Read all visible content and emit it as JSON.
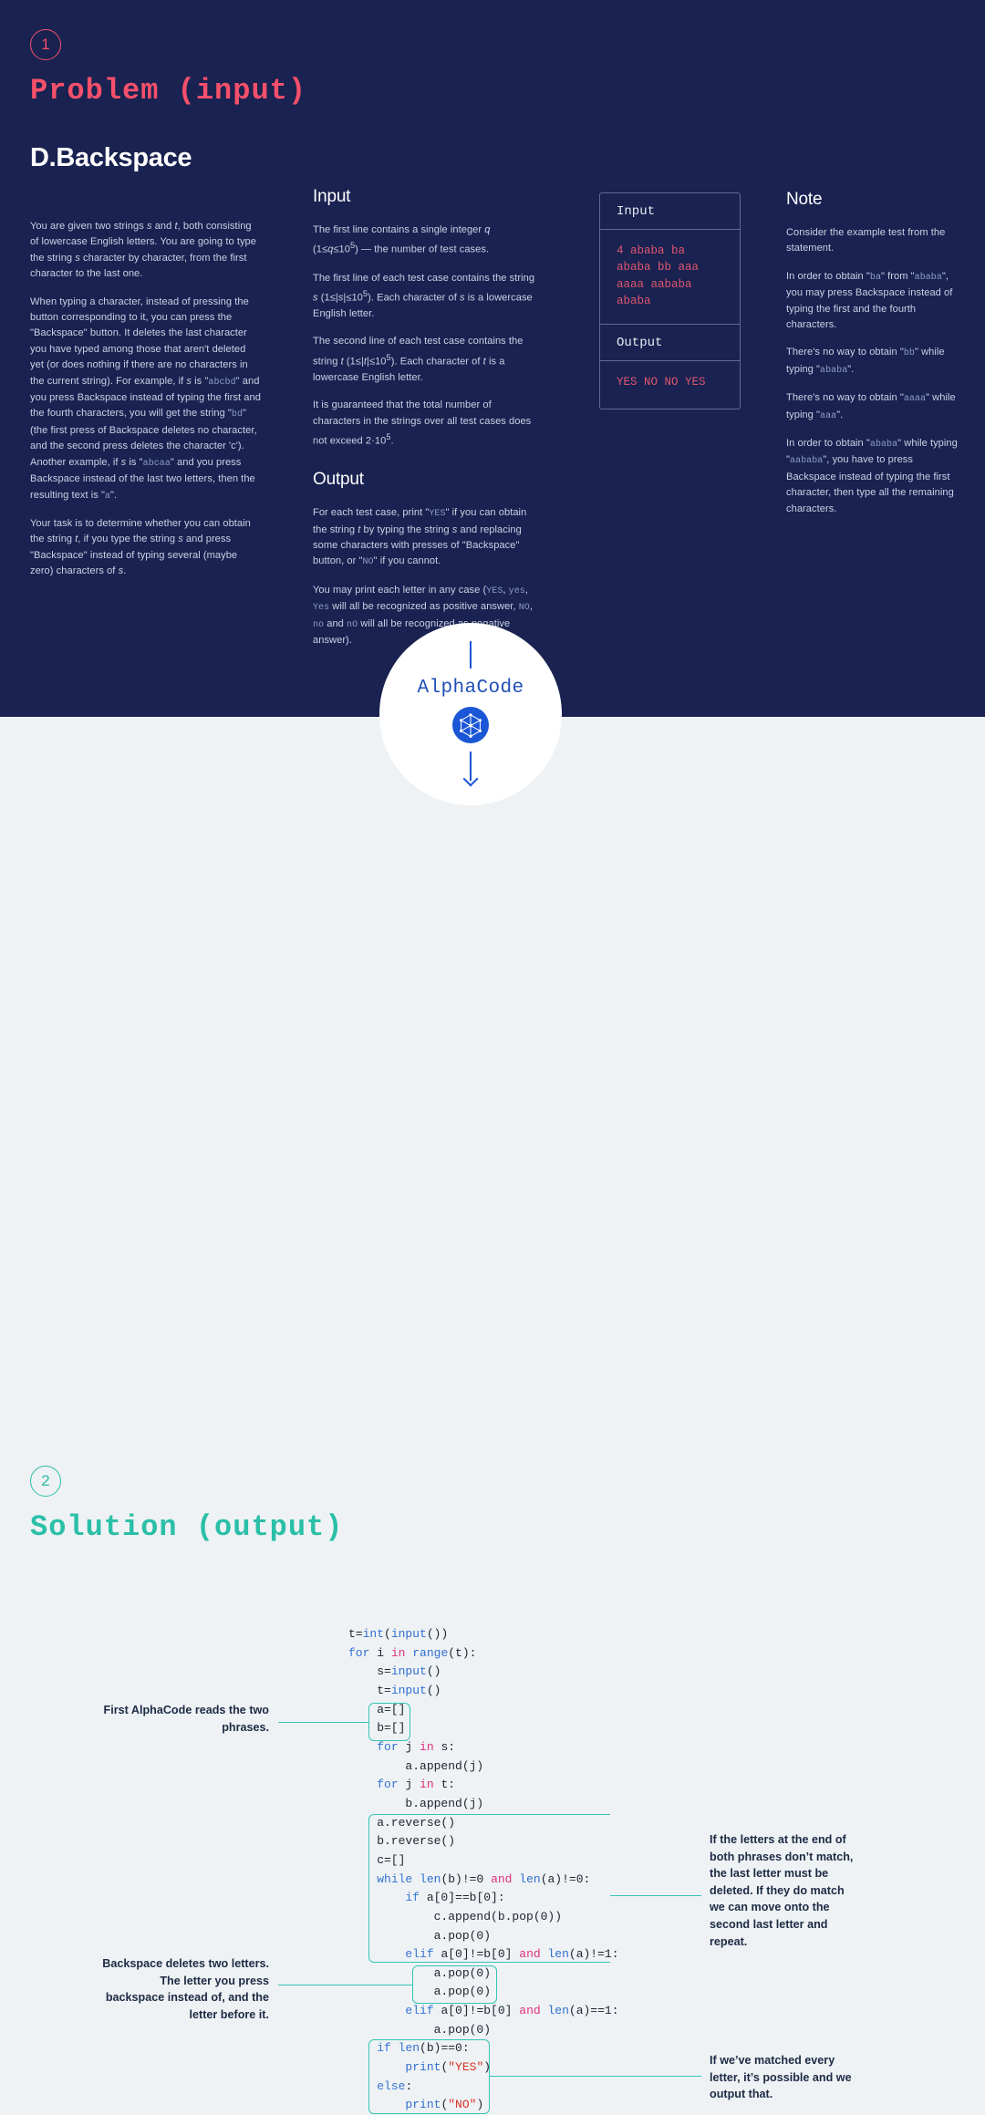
{
  "problem": {
    "badge": "1",
    "section_title": "Problem (input)",
    "title": "D.Backspace",
    "statement": [
      "You are given two strings <em>s</em> and <em>t</em>, both consisting of lowercase English letters. You are going to type the string <em>s</em> character by character, from the first character to the last one.",
      "When typing a character, instead of pressing the button corresponding to it, you can press the \"Backspace\" button. It deletes the last character you have typed among those that aren't deleted yet (or does nothing if there are no characters in the current string). For example, if <em>s</em> is \"<span class=\"mono\">abcbd</span>\" and you press Backspace instead of typing the first and the fourth characters, you will get the string \"<span class=\"mono\">bd</span>\" (the first press of Backspace deletes no character, and the second press deletes the character 'c'). Another example, if <em>s</em> is \"<span class=\"mono\">abcaa</span>\" and you press Backspace instead of the last two letters, then the resulting text is \"<span class=\"mono\">a</span>\".",
      "Your task is to determine whether you can obtain the string <em>t</em>, if you type the string <em>s</em> and press \"Backspace\" instead of typing several (maybe zero) characters of <em>s</em>."
    ],
    "input": {
      "heading": "Input",
      "paragraphs": [
        "The first line contains a single integer <em>q</em> (1≤<em>q</em>≤10<sup>5</sup>) — the number of test cases.",
        "The first line of each test case contains the string <em>s</em> (1≤|<em>s</em>|≤10<sup>5</sup>). Each character of <em>s</em> is a lowercase English letter.",
        "The second line of each test case contains the string <em>t</em> (1≤|<em>t</em>|≤10<sup>5</sup>). Each character of <em>t</em> is a lowercase English letter.",
        "It is guaranteed that the total number of characters in the strings over all test cases does not exceed 2·10<sup>5</sup>."
      ]
    },
    "output": {
      "heading": "Output",
      "paragraphs": [
        "For each test case, print \"<span class=\"mono\">YES</span>\" if you can obtain the string <em>t</em> by typing the string <em>s</em> and replacing some characters with presses of \"Backspace\" button, or \"<span class=\"mono\">NO</span>\" if you cannot.",
        "You may print each letter in any case (<span class=\"mono\">YES</span>, <span class=\"mono\">yes</span>, <span class=\"mono\">Yes</span> will all be recognized as positive answer, <span class=\"mono\">NO</span>, <span class=\"mono\">no</span> and <span class=\"mono\">nO</span>  will all be recognized as negative answer)."
      ]
    },
    "example": {
      "input_label": "Input",
      "input_lines": "4\nababa\nba\nababa\nbb\naaa\naaaa\naababa\nababa",
      "output_label": "Output",
      "output_lines": "YES\nNO\nNO\nYES"
    },
    "note": {
      "heading": "Note",
      "paragraphs": [
        "Consider the example test from the statement.",
        "In order to obtain \"<span class=\"mono\">ba</span>\" from \"<span class=\"mono\">ababa</span>\", you may press Backspace instead of typing the first and the fourth characters.",
        "There's no way to obtain \"<span class=\"mono\">bb</span>\" while typing \"<span class=\"mono\">ababa</span>\".",
        "There's no way to obtain \"<span class=\"mono\">aaaa</span>\" while typing \"<span class=\"mono\">aaa</span>\".",
        "In order to obtain \"<span class=\"mono\">ababa</span>\" while typing \"<span class=\"mono\">aababa</span>\", you have to press Backspace instead of typing the first character, then type all the remaining characters."
      ]
    }
  },
  "alphacode": {
    "label": "AlphaCode"
  },
  "solution": {
    "badge": "2",
    "section_title": "Solution (output)",
    "code_html": "t=<span class=\"k-func\">int</span>(<span class=\"k-func\">input</span>())\n<span class=\"k-blue\">for</span> i <span class=\"k-pink\">in</span> <span class=\"k-func\">range</span>(t):\n    s=<span class=\"k-func\">input</span>()\n    t=<span class=\"k-func\">input</span>()\n    a=[]\n    b=[]\n    <span class=\"k-blue\">for</span> j <span class=\"k-pink\">in</span> s:\n        a.append(j)\n    <span class=\"k-blue\">for</span> j <span class=\"k-pink\">in</span> t:\n        b.append(j)\n    a.reverse()\n    b.reverse()\n    c=[]\n    <span class=\"k-blue\">while</span> <span class=\"k-func\">len</span>(b)!=0 <span class=\"k-pink\">and</span> <span class=\"k-func\">len</span>(a)!=0:\n        <span class=\"k-blue\">if</span> a[0]==b[0]:\n            c.append(b.pop(0))\n            a.pop(0)\n        <span class=\"k-blue\">elif</span> a[0]!=b[0] <span class=\"k-pink\">and</span> <span class=\"k-func\">len</span>(a)!=1:\n            a.pop(0)\n            a.pop(0)\n        <span class=\"k-blue\">elif</span> a[0]!=b[0] <span class=\"k-pink\">and</span> <span class=\"k-func\">len</span>(a)==1:\n            a.pop(0)\n    <span class=\"k-blue\">if</span> <span class=\"k-func\">len</span>(b)==0:\n        <span class=\"k-func\">print</span>(<span class=\"k-str\">\"YES\"</span>)\n    <span class=\"k-blue\">else</span>:\n        <span class=\"k-func\">print</span>(<span class=\"k-str\">\"NO\"</span>)",
    "code_plain": "t=int(input())\nfor i in range(t):\n    s=input()\n    t=input()\n    a=[]\n    b=[]\n    for j in s:\n        a.append(j)\n    for j in t:\n        b.append(j)\n    a.reverse()\n    b.reverse()\n    c=[]\n    while len(b)!=0 and len(a)!=0:\n        if a[0]==b[0]:\n            c.append(b.pop(0))\n            a.pop(0)\n        elif a[0]!=b[0] and len(a)!=1:\n            a.pop(0)\n            a.pop(0)\n        elif a[0]!=b[0] and len(a)==1:\n            a.pop(0)\n    if len(b)==0:\n        print(\"YES\")\n    else:\n        print(\"NO\")",
    "annotations": [
      "First AlphaCode reads the two phrases.",
      "If the letters at the end of both phrases don’t match, the last letter must be deleted. If they do match we can move onto the second last letter and repeat.",
      "Backspace deletes two letters. The letter you press backspace instead of, and the letter before it.",
      "If we’ve matched every letter, it’s possible and we output that."
    ]
  },
  "colors": {
    "dark_bg": "#192250",
    "light_bg": "#eef2f4",
    "pink": "#f5506b",
    "teal": "#2bbfa8",
    "highlight": "#35c4b5",
    "code_blue": "#3573d4",
    "code_pink": "#e0307e",
    "example_text": "#e0566f"
  }
}
